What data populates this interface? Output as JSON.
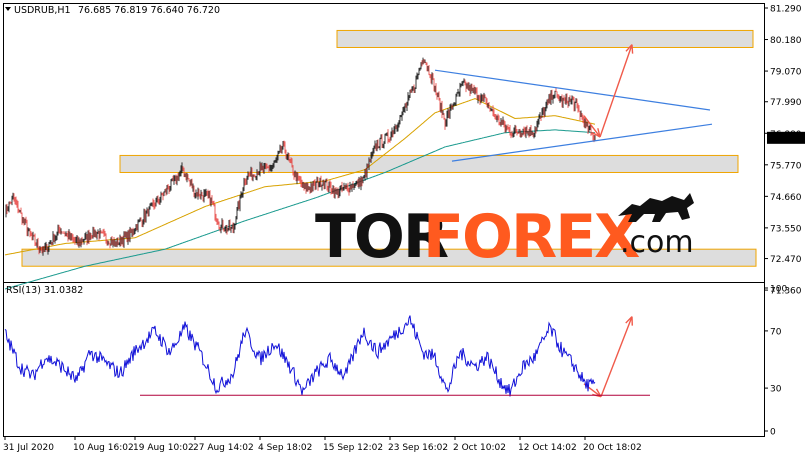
{
  "header": {
    "title": "USDRUB,H1",
    "ohlc": "76.685 76.819 76.640 76.720",
    "rsi_label": "RSI(13) 31.0382"
  },
  "watermark": {
    "part1": "TOR",
    "part2": "FOREX",
    "part3": ".com"
  },
  "colors": {
    "bull_candle": "#000000",
    "bear_candle": "#e53935",
    "ma_fast": "#d8a200",
    "ma_slow": "#1a9a8e",
    "trendline": "#3d7fe0",
    "arrow": "#f05a4a",
    "rsi": "#1010d8",
    "zone_fill": "#d9d9d9",
    "zone_border": "#f0a500",
    "rsi_level_line": "#b0003a",
    "price_tag_bg": "#000000"
  },
  "chart_data": [
    {
      "type": "candlestick",
      "symbol": "USDRUB",
      "timeframe": "H1",
      "last_price": "76.720",
      "ylim": [
        70.8,
        81.29
      ],
      "y_ticks": [
        "81.290",
        "80.180",
        "79.070",
        "77.990",
        "76.880",
        "75.770",
        "74.660",
        "73.550",
        "72.470",
        "71.360"
      ],
      "x_tick_labels": [
        "31 Jul 2020",
        "10 Aug 16:02",
        "19 Aug 10:02",
        "27 Aug 14:02",
        "4 Sep 18:02",
        "15 Sep 12:02",
        "23 Sep 16:02",
        "2 Oct 10:02",
        "12 Oct 14:02",
        "20 Oct 18:02"
      ],
      "x_tick_index": [
        0,
        70,
        130,
        190,
        255,
        320,
        385,
        450,
        515,
        580
      ],
      "anchors": [
        [
          0,
          74.1
        ],
        [
          8,
          74.6
        ],
        [
          25,
          73.3
        ],
        [
          38,
          72.7
        ],
        [
          55,
          73.5
        ],
        [
          72,
          73.0
        ],
        [
          90,
          73.4
        ],
        [
          110,
          73.0
        ],
        [
          125,
          73.3
        ],
        [
          140,
          74.0
        ],
        [
          160,
          74.8
        ],
        [
          178,
          75.6
        ],
        [
          190,
          74.8
        ],
        [
          205,
          74.6
        ],
        [
          215,
          73.6
        ],
        [
          228,
          73.5
        ],
        [
          240,
          75.3
        ],
        [
          255,
          75.6
        ],
        [
          268,
          75.7
        ],
        [
          278,
          76.4
        ],
        [
          290,
          75.4
        ],
        [
          300,
          74.9
        ],
        [
          318,
          75.2
        ],
        [
          330,
          74.8
        ],
        [
          345,
          75.0
        ],
        [
          358,
          75.2
        ],
        [
          370,
          76.4
        ],
        [
          385,
          76.8
        ],
        [
          398,
          77.6
        ],
        [
          410,
          78.6
        ],
        [
          418,
          79.6
        ],
        [
          425,
          79.0
        ],
        [
          432,
          78.2
        ],
        [
          440,
          77.3
        ],
        [
          448,
          77.9
        ],
        [
          458,
          78.6
        ],
        [
          470,
          78.3
        ],
        [
          480,
          78.0
        ],
        [
          492,
          77.4
        ],
        [
          500,
          77.1
        ],
        [
          508,
          76.9
        ],
        [
          518,
          77.0
        ],
        [
          528,
          76.9
        ],
        [
          538,
          77.6
        ],
        [
          548,
          78.3
        ],
        [
          558,
          78.0
        ],
        [
          568,
          78.0
        ],
        [
          576,
          77.5
        ],
        [
          583,
          77.0
        ],
        [
          590,
          76.72
        ]
      ],
      "ma_fast": [
        [
          0,
          72.6
        ],
        [
          60,
          73.0
        ],
        [
          130,
          73.2
        ],
        [
          200,
          74.3
        ],
        [
          260,
          75.0
        ],
        [
          320,
          75.2
        ],
        [
          360,
          75.6
        ],
        [
          400,
          76.7
        ],
        [
          430,
          77.6
        ],
        [
          470,
          78.1
        ],
        [
          510,
          77.4
        ],
        [
          550,
          77.5
        ],
        [
          590,
          77.2
        ]
      ],
      "ma_slow": [
        [
          0,
          71.4
        ],
        [
          80,
          72.2
        ],
        [
          160,
          72.8
        ],
        [
          240,
          73.8
        ],
        [
          310,
          74.6
        ],
        [
          380,
          75.5
        ],
        [
          440,
          76.4
        ],
        [
          500,
          76.9
        ],
        [
          550,
          77.0
        ],
        [
          590,
          76.9
        ]
      ],
      "zones": [
        {
          "from": 79.9,
          "to": 80.5,
          "x_from": 337,
          "x_to": 753
        },
        {
          "from": 75.5,
          "to": 76.1,
          "x_from": 120,
          "x_to": 738
        },
        {
          "from": 72.2,
          "to": 72.8,
          "x_from": 22,
          "x_to": 756
        }
      ],
      "trendlines": [
        {
          "x1": 435,
          "y1": 79.1,
          "x2": 710,
          "y2": 77.7
        },
        {
          "x1": 452,
          "y1": 75.9,
          "x2": 712,
          "y2": 77.2
        }
      ],
      "forecast_arrows": [
        {
          "from": [
            584,
            77.5
          ],
          "to": [
            600,
            76.75
          ]
        },
        {
          "from": [
            600,
            76.75
          ],
          "to": [
            632,
            80.0
          ]
        }
      ]
    },
    {
      "type": "line",
      "name": "RSI(13)",
      "last_value": 31.0382,
      "ylim": [
        0,
        100
      ],
      "y_ticks": [
        100,
        70,
        30,
        0
      ],
      "level_line": {
        "value": 25,
        "x_from": 140,
        "x_to": 650
      },
      "anchors": [
        [
          0,
          68
        ],
        [
          15,
          45
        ],
        [
          28,
          38
        ],
        [
          40,
          52
        ],
        [
          55,
          46
        ],
        [
          72,
          35
        ],
        [
          85,
          55
        ],
        [
          100,
          48
        ],
        [
          115,
          40
        ],
        [
          130,
          56
        ],
        [
          150,
          70
        ],
        [
          165,
          55
        ],
        [
          180,
          72
        ],
        [
          195,
          55
        ],
        [
          212,
          30
        ],
        [
          228,
          40
        ],
        [
          240,
          70
        ],
        [
          255,
          50
        ],
        [
          270,
          62
        ],
        [
          285,
          45
        ],
        [
          298,
          27
        ],
        [
          310,
          40
        ],
        [
          325,
          50
        ],
        [
          340,
          38
        ],
        [
          358,
          70
        ],
        [
          372,
          55
        ],
        [
          388,
          66
        ],
        [
          405,
          78
        ],
        [
          418,
          55
        ],
        [
          430,
          52
        ],
        [
          442,
          27
        ],
        [
          455,
          55
        ],
        [
          470,
          45
        ],
        [
          482,
          52
        ],
        [
          495,
          35
        ],
        [
          505,
          27
        ],
        [
          518,
          45
        ],
        [
          530,
          52
        ],
        [
          545,
          72
        ],
        [
          558,
          55
        ],
        [
          570,
          45
        ],
        [
          580,
          33
        ],
        [
          590,
          31
        ]
      ],
      "forecast_arrows": [
        {
          "from": [
            584,
            33
          ],
          "to": [
            601,
            24
          ]
        },
        {
          "from": [
            601,
            24
          ],
          "to": [
            632,
            80
          ]
        }
      ]
    }
  ]
}
